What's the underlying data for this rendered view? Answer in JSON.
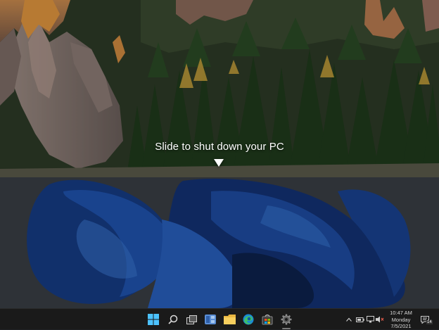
{
  "shutdown": {
    "prompt": "Slide to shut down your PC"
  },
  "taskbar": {
    "pinned": [
      {
        "name": "start",
        "icon": "windows-logo-icon"
      },
      {
        "name": "search",
        "icon": "search-icon"
      },
      {
        "name": "task-view",
        "icon": "task-view-icon"
      },
      {
        "name": "widgets",
        "icon": "widgets-icon"
      },
      {
        "name": "file-explorer",
        "icon": "folder-icon"
      },
      {
        "name": "edge",
        "icon": "edge-icon"
      },
      {
        "name": "store",
        "icon": "store-icon"
      },
      {
        "name": "settings",
        "icon": "gear-icon"
      }
    ],
    "tray": {
      "icons": [
        "chevron-up-icon",
        "battery-icon",
        "network-icon",
        "volume-muted-icon"
      ],
      "time": "10:47 AM",
      "day": "Monday",
      "date": "7/5/2021",
      "notification_count": "14"
    }
  },
  "colors": {
    "taskbar_bg": "#1a1a1a",
    "wallpaper_blue": "#1d3f8f",
    "desktop_dim": "#3a3f45"
  }
}
